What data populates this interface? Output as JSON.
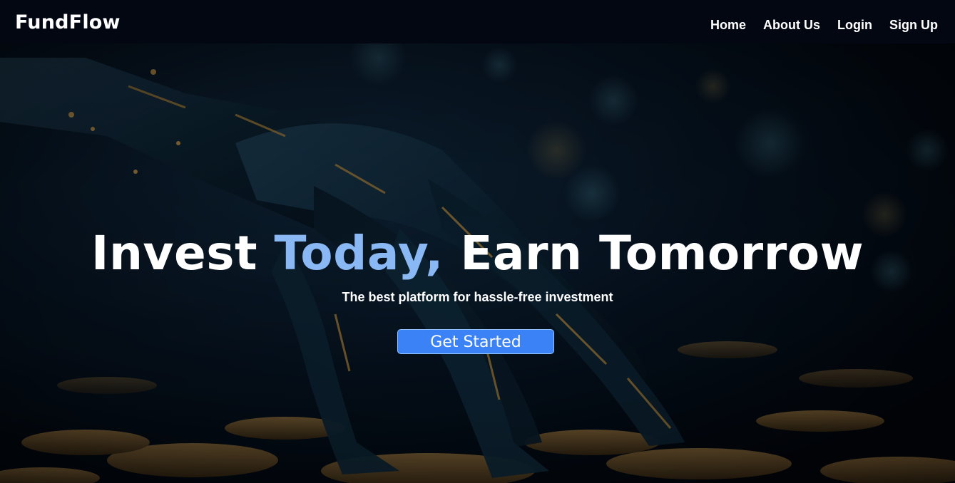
{
  "navbar": {
    "brand": "FundFlow",
    "links": [
      {
        "label": "Home"
      },
      {
        "label": "About Us"
      },
      {
        "label": "Login"
      },
      {
        "label": "Sign Up"
      }
    ]
  },
  "hero": {
    "headline_part1": "Invest ",
    "headline_accent": "Today,",
    "headline_part2": " Earn Tomorrow",
    "subheadline": "The best platform for hassle-free investment",
    "cta_label": "Get Started",
    "accent_color": "#8ab8f4",
    "cta_color": "#3b82f6",
    "background_image": "robotic-hand-over-gold-coins"
  }
}
